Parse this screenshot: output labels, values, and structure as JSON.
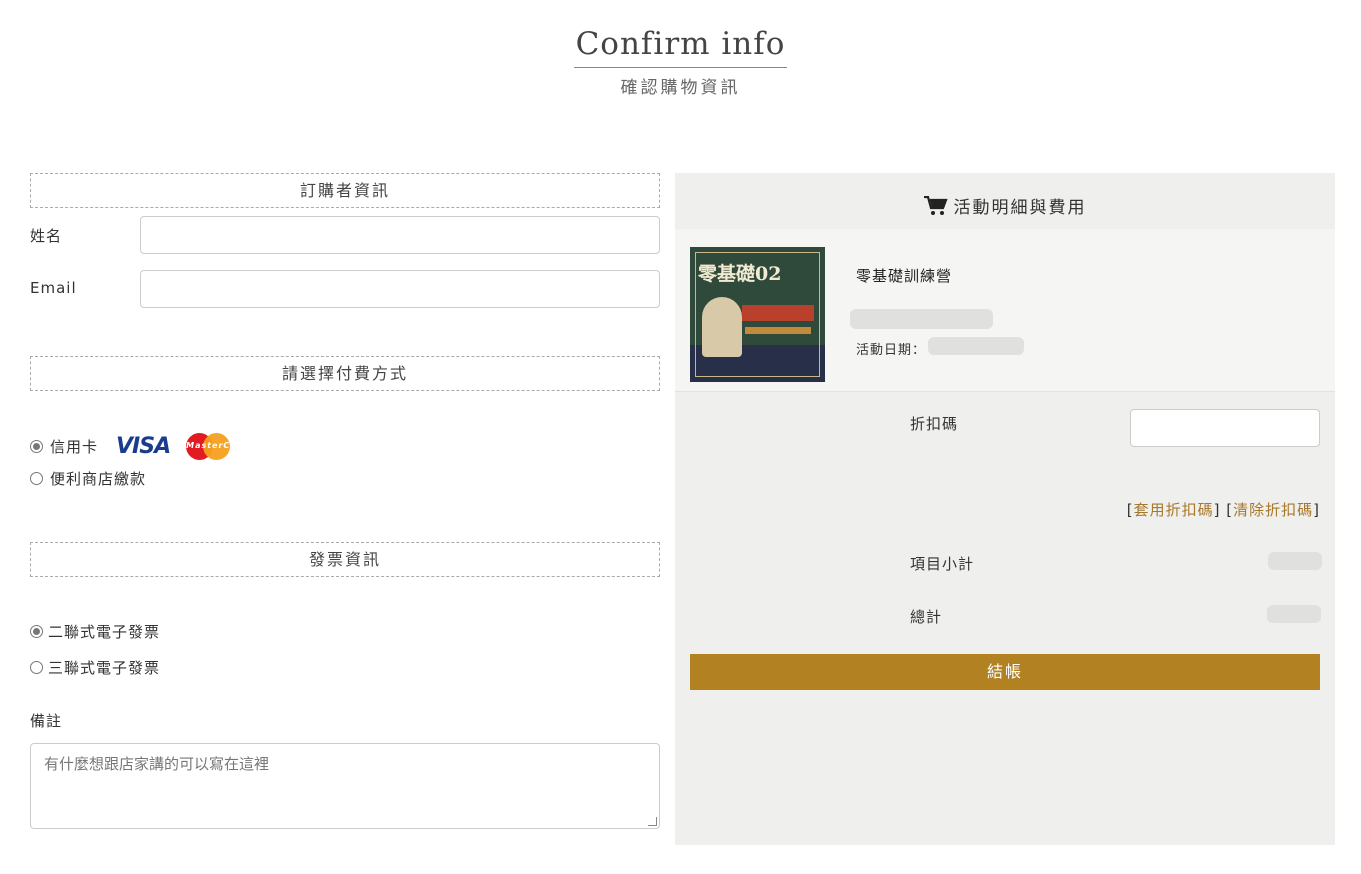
{
  "header": {
    "title_en": "Confirm info",
    "title_zh": "確認購物資訊"
  },
  "buyer": {
    "section_title": "訂購者資訊",
    "name_label": "姓名",
    "email_label": "Email",
    "name_value": "",
    "email_value": ""
  },
  "payment": {
    "section_title": "請選擇付費方式",
    "options": [
      {
        "label": "信用卡",
        "selected": true
      },
      {
        "label": "便利商店繳款",
        "selected": false
      }
    ],
    "card_brands": [
      "VISA",
      "MasterCard"
    ]
  },
  "invoice": {
    "section_title": "發票資訊",
    "options": [
      {
        "label": "二聯式電子發票",
        "selected": true
      },
      {
        "label": "三聯式電子發票",
        "selected": false
      }
    ]
  },
  "notes": {
    "label": "備註",
    "placeholder": "有什麼想跟店家講的可以寫在這裡"
  },
  "summary": {
    "title": "活動明細與費用",
    "icon": "cart-icon",
    "product": {
      "name": "零基礎訓練營",
      "date_label": "活動日期：",
      "thumb_title": "零基礎02",
      "thumb_image": "event-poster"
    },
    "coupon_label": "折扣碼",
    "coupon_value": "",
    "apply_link": "套用折扣碼",
    "clear_link": "清除折扣碼",
    "subtotal_label": "項目小計",
    "total_label": "總計",
    "checkout_label": "結帳"
  },
  "colors": {
    "accent": "#b28121",
    "panel_bg": "#efefed",
    "link": "#a8782a"
  }
}
